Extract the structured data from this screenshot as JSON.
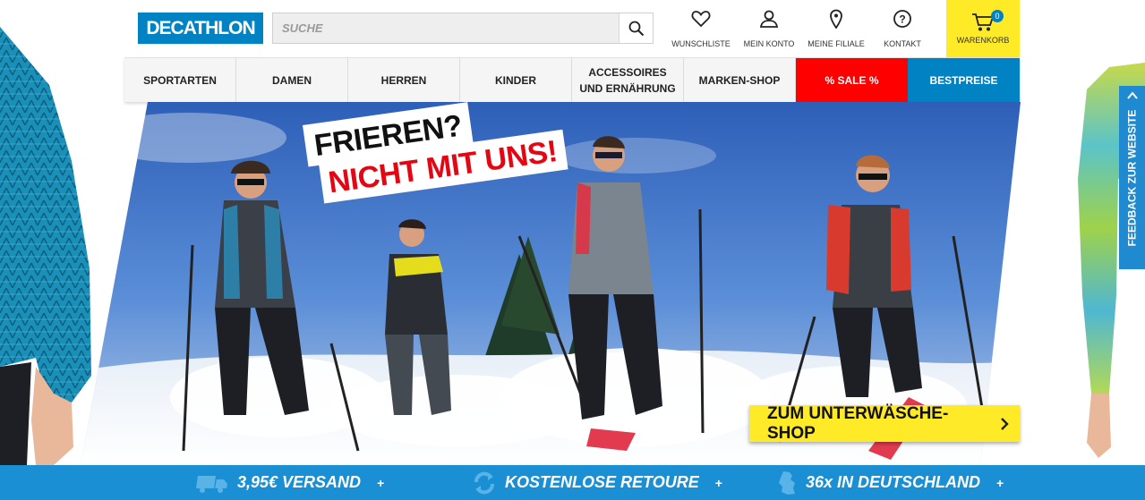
{
  "header": {
    "logo_text": "DECATHLON",
    "search_placeholder": "SUCHE",
    "icons": [
      {
        "name": "heart-icon",
        "label": "WUNSCHLISTE"
      },
      {
        "name": "user-icon",
        "label": "MEIN KONTO"
      },
      {
        "name": "location-pin-icon",
        "label": "MEINE FILIALE"
      },
      {
        "name": "question-icon",
        "label": "KONTAKT"
      }
    ],
    "cart": {
      "label": "WARENKORB",
      "count": "0"
    }
  },
  "nav": {
    "items": [
      "SPORTARTEN",
      "DAMEN",
      "HERREN",
      "KINDER",
      "ACCESSOIRES UND ERNÄHRUNG",
      "MARKEN-SHOP",
      "% SALE %",
      "BESTPREISE"
    ]
  },
  "hero": {
    "headline_line1": "FRIEREN?",
    "headline_line2": "NICHT MIT UNS!",
    "cta_label": "ZUM UNTERWÄSCHE-SHOP"
  },
  "feedback_tab": "FEEDBACK ZUR WEBSITE",
  "usp_bar": [
    {
      "icon": "truck-icon",
      "text": "3,95€ VERSAND"
    },
    {
      "icon": "return-arrows-icon",
      "text": "KOSTENLOSE RETOURE"
    },
    {
      "icon": "germany-map-icon",
      "text": "36x IN DEUTSCHLAND"
    }
  ],
  "colors": {
    "brand_blue": "#0082c3",
    "cart_yellow": "#ffea28",
    "sale_red": "#ff0000",
    "usp_bar_blue": "#1a8fd3"
  }
}
